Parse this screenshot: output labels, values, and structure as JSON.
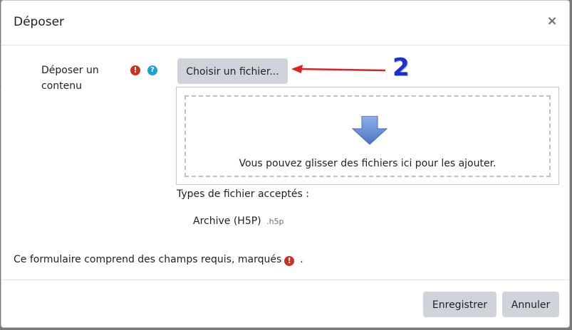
{
  "dialog": {
    "title": "Déposer",
    "close_symbol": "×"
  },
  "form": {
    "field_label": "Déposer un contenu",
    "required_icon": "exclamation-circle-icon",
    "help_icon": "question-circle-icon",
    "choose_button_label": "Choisir un fichier...",
    "dropzone_text": "Vous pouvez glisser des fichiers ici pour les ajouter.",
    "accepted_types_label": "Types de fichier acceptés :",
    "accepted_types": [
      {
        "name": "Archive (H5P)",
        "extension": ".h5p"
      }
    ],
    "required_note": "Ce formulaire comprend des champs requis, marqués",
    "required_note_end": "."
  },
  "annotation": {
    "number": "2",
    "arrow_color": "#e02020",
    "number_color": "#1b2fcf"
  },
  "footer": {
    "save_label": "Enregistrer",
    "cancel_label": "Annuler"
  },
  "colors": {
    "required": "#ca3120",
    "help": "#1aa3d6",
    "button_bg": "#ced4da",
    "drop_arrow": "#6b8fd6"
  }
}
